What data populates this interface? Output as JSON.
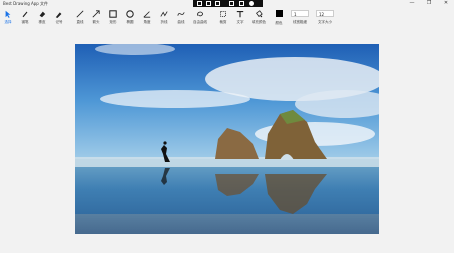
{
  "window": {
    "app_title": "Best Drawing App",
    "menu_file": "文件",
    "minimize": "—",
    "maximize": "❐",
    "close": "✕"
  },
  "toolbar": {
    "tools": [
      {
        "label": "选择",
        "icon": "cursor-icon",
        "active": true
      },
      {
        "label": "钢笔",
        "icon": "pen-icon"
      },
      {
        "label": "橡皮",
        "icon": "eraser-icon"
      },
      {
        "label": "记号",
        "icon": "highlighter-icon"
      },
      {
        "label": "直线",
        "icon": "line-icon"
      },
      {
        "label": "箭头",
        "icon": "arrow-icon"
      },
      {
        "label": "矩形",
        "icon": "rectangle-icon"
      },
      {
        "label": "椭圆",
        "icon": "ellipse-icon"
      },
      {
        "label": "角度",
        "icon": "angle-icon"
      },
      {
        "label": "折线",
        "icon": "polyline-icon"
      },
      {
        "label": "曲线",
        "icon": "curve-icon"
      },
      {
        "label": "自由曲线",
        "icon": "freeform-icon"
      },
      {
        "label": "裁剪",
        "icon": "crop-icon"
      },
      {
        "label": "文字",
        "icon": "text-icon"
      },
      {
        "label": "填充颜色",
        "icon": "fill-icon"
      }
    ],
    "color_label": "颜色",
    "color_value": "#000000",
    "line_width_value": "1",
    "line_width_label": "线宽粗细",
    "font_size_value": "12",
    "font_size_label": "文字大小"
  },
  "canvas": {
    "image": "beach-photo-with-rock-arches-and-runner"
  }
}
